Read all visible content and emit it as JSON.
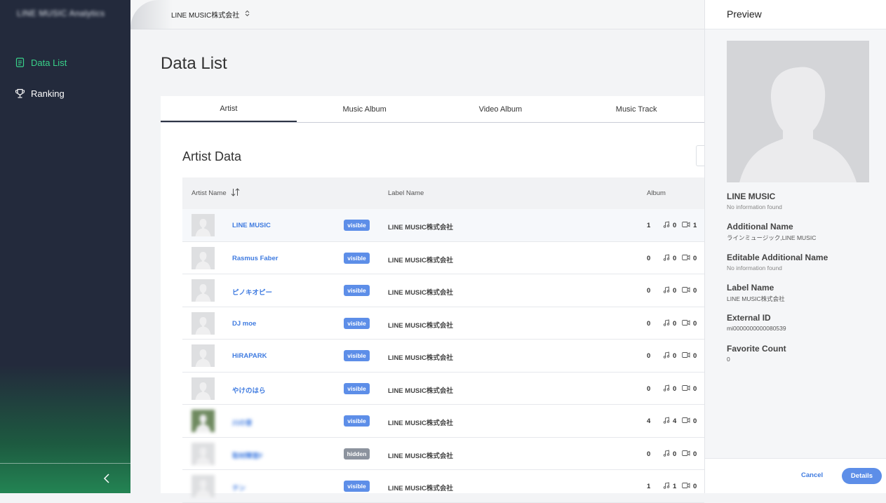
{
  "app": {
    "brand": "LINE MUSIC Analytics"
  },
  "sidebar": {
    "items": [
      {
        "label": "Data List",
        "icon": "document-icon",
        "active": true
      },
      {
        "label": "Ranking",
        "icon": "trophy-icon",
        "active": false
      }
    ]
  },
  "topbar": {
    "company": "LINE MUSIC株式会社"
  },
  "page": {
    "title": "Data List"
  },
  "tabs": [
    "Artist",
    "Music Album",
    "Video Album",
    "Music Track"
  ],
  "section": {
    "title": "Artist Data"
  },
  "table": {
    "headers": {
      "artist": "Artist Name",
      "label": "Label Name",
      "album": "Album"
    },
    "rows": [
      {
        "name": "LINE MUSIC",
        "status": "visible",
        "label": "LINE MUSIC株式会社",
        "album": "1",
        "tracks": "0",
        "videos": "1"
      },
      {
        "name": "Rasmus Faber",
        "status": "visible",
        "label": "LINE MUSIC株式会社",
        "album": "0",
        "tracks": "0",
        "videos": "0"
      },
      {
        "name": "ピノキオピー",
        "status": "visible",
        "label": "LINE MUSIC株式会社",
        "album": "0",
        "tracks": "0",
        "videos": "0"
      },
      {
        "name": "DJ moe",
        "status": "visible",
        "label": "LINE MUSIC株式会社",
        "album": "0",
        "tracks": "0",
        "videos": "0"
      },
      {
        "name": "HiRAPARK",
        "status": "visible",
        "label": "LINE MUSIC株式会社",
        "album": "0",
        "tracks": "0",
        "videos": "0"
      },
      {
        "name": "やけのはら",
        "status": "visible",
        "label": "LINE MUSIC株式会社",
        "album": "0",
        "tracks": "0",
        "videos": "0"
      },
      {
        "name": "川の音",
        "status": "visible",
        "label": "LINE MUSIC株式会社",
        "album": "4",
        "tracks": "4",
        "videos": "0"
      },
      {
        "name": "取材陣営F",
        "status": "hidden",
        "label": "LINE MUSIC株式会社",
        "album": "0",
        "tracks": "0",
        "videos": "0"
      },
      {
        "name": "テン",
        "status": "visible",
        "label": "LINE MUSIC株式会社",
        "album": "1",
        "tracks": "1",
        "videos": "0"
      }
    ]
  },
  "preview": {
    "title": "Preview",
    "name": "LINE MUSIC",
    "name_value": "No information found",
    "fields": [
      {
        "title": "Additional Name",
        "value": "ラインミュージック,LINE MUSIC"
      },
      {
        "title": "Editable Additional Name",
        "value": "No information found"
      },
      {
        "title": "Label Name",
        "value": "LINE MUSIC株式会社"
      },
      {
        "title": "External ID",
        "value": "mi0000000000080539"
      },
      {
        "title": "Favorite Count",
        "value": "0"
      }
    ],
    "cancel": "Cancel",
    "details": "Details"
  },
  "colors": {
    "accent": "#5d8ee8",
    "active_nav": "#39d28a",
    "sidebar": "#232a3c"
  }
}
